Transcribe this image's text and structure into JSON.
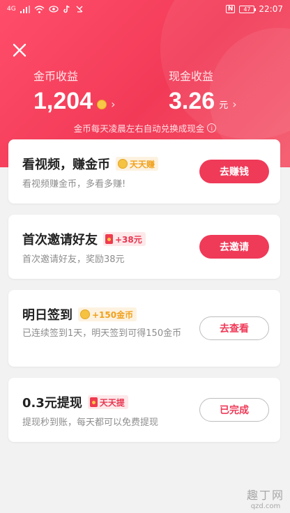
{
  "status_bar": {
    "signal": "4G",
    "time": "22:07",
    "battery": "47",
    "nfc": "N"
  },
  "header": {
    "coins_label": "金币收益",
    "coins_value": "1,204",
    "cash_label": "现金收益",
    "cash_value": "3.26",
    "cash_unit": "元",
    "chevron": "›",
    "notice": "金币每天凌晨左右自动兑换成现金",
    "info": "i"
  },
  "tasks": [
    {
      "title": "看视频，赚金币",
      "badge_type": "coin",
      "badge_text": "天天赚",
      "desc": "看视频赚金币，多看多赚!",
      "button": "去赚钱",
      "button_style": "filled"
    },
    {
      "title": "首次邀请好友",
      "badge_type": "envelope",
      "badge_text": "+38元",
      "desc": "首次邀请好友，奖励38元",
      "button": "去邀请",
      "button_style": "filled"
    },
    {
      "title": "明日签到",
      "badge_type": "coin",
      "badge_text": "+150金币",
      "desc": "已连续签到1天，明天签到可得150金币",
      "button": "去查看",
      "button_style": "outline"
    },
    {
      "title": "0.3元提现",
      "badge_type": "envelope",
      "badge_text": "天天提",
      "desc": "提现秒到账，每天都可以免费提现",
      "button": "已完成",
      "button_style": "outline"
    }
  ],
  "watermark": {
    "name": "趣丁网",
    "url": "qzd.com"
  },
  "colors": {
    "brand_red": "#ef3a58",
    "coin_gold": "#f5c242",
    "badge_gold_text": "#f0a11c"
  }
}
